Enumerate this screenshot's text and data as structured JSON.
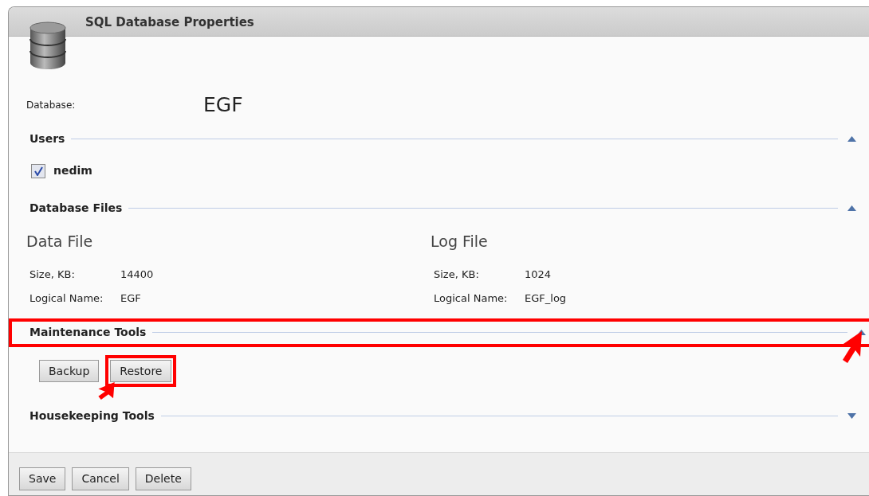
{
  "window": {
    "title": "SQL Database Properties"
  },
  "database": {
    "label": "Database:",
    "value": "EGF"
  },
  "sections": [
    {
      "kind": "users",
      "title": "Users",
      "expanded": true,
      "highlighted": false,
      "users": [
        {
          "name": "nedim",
          "checked": true
        }
      ]
    },
    {
      "kind": "files",
      "title": "Database Files",
      "expanded": true,
      "highlighted": false,
      "files": [
        {
          "title": "Data File",
          "fields": [
            {
              "label": "Size, KB:",
              "value": "14400"
            },
            {
              "label": "Logical Name:",
              "value": "EGF"
            }
          ]
        },
        {
          "title": "Log File",
          "fields": [
            {
              "label": "Size, KB:",
              "value": "1024"
            },
            {
              "label": "Logical Name:",
              "value": "EGF_log"
            }
          ]
        }
      ]
    },
    {
      "kind": "tools",
      "title": "Maintenance Tools",
      "expanded": true,
      "highlighted": true,
      "buttons": [
        {
          "label": "Backup",
          "highlighted": false
        },
        {
          "label": "Restore",
          "highlighted": true
        }
      ]
    },
    {
      "kind": "tools",
      "title": "Housekeeping Tools",
      "expanded": false,
      "highlighted": false
    }
  ],
  "footer_buttons": [
    "Save",
    "Cancel",
    "Delete"
  ]
}
